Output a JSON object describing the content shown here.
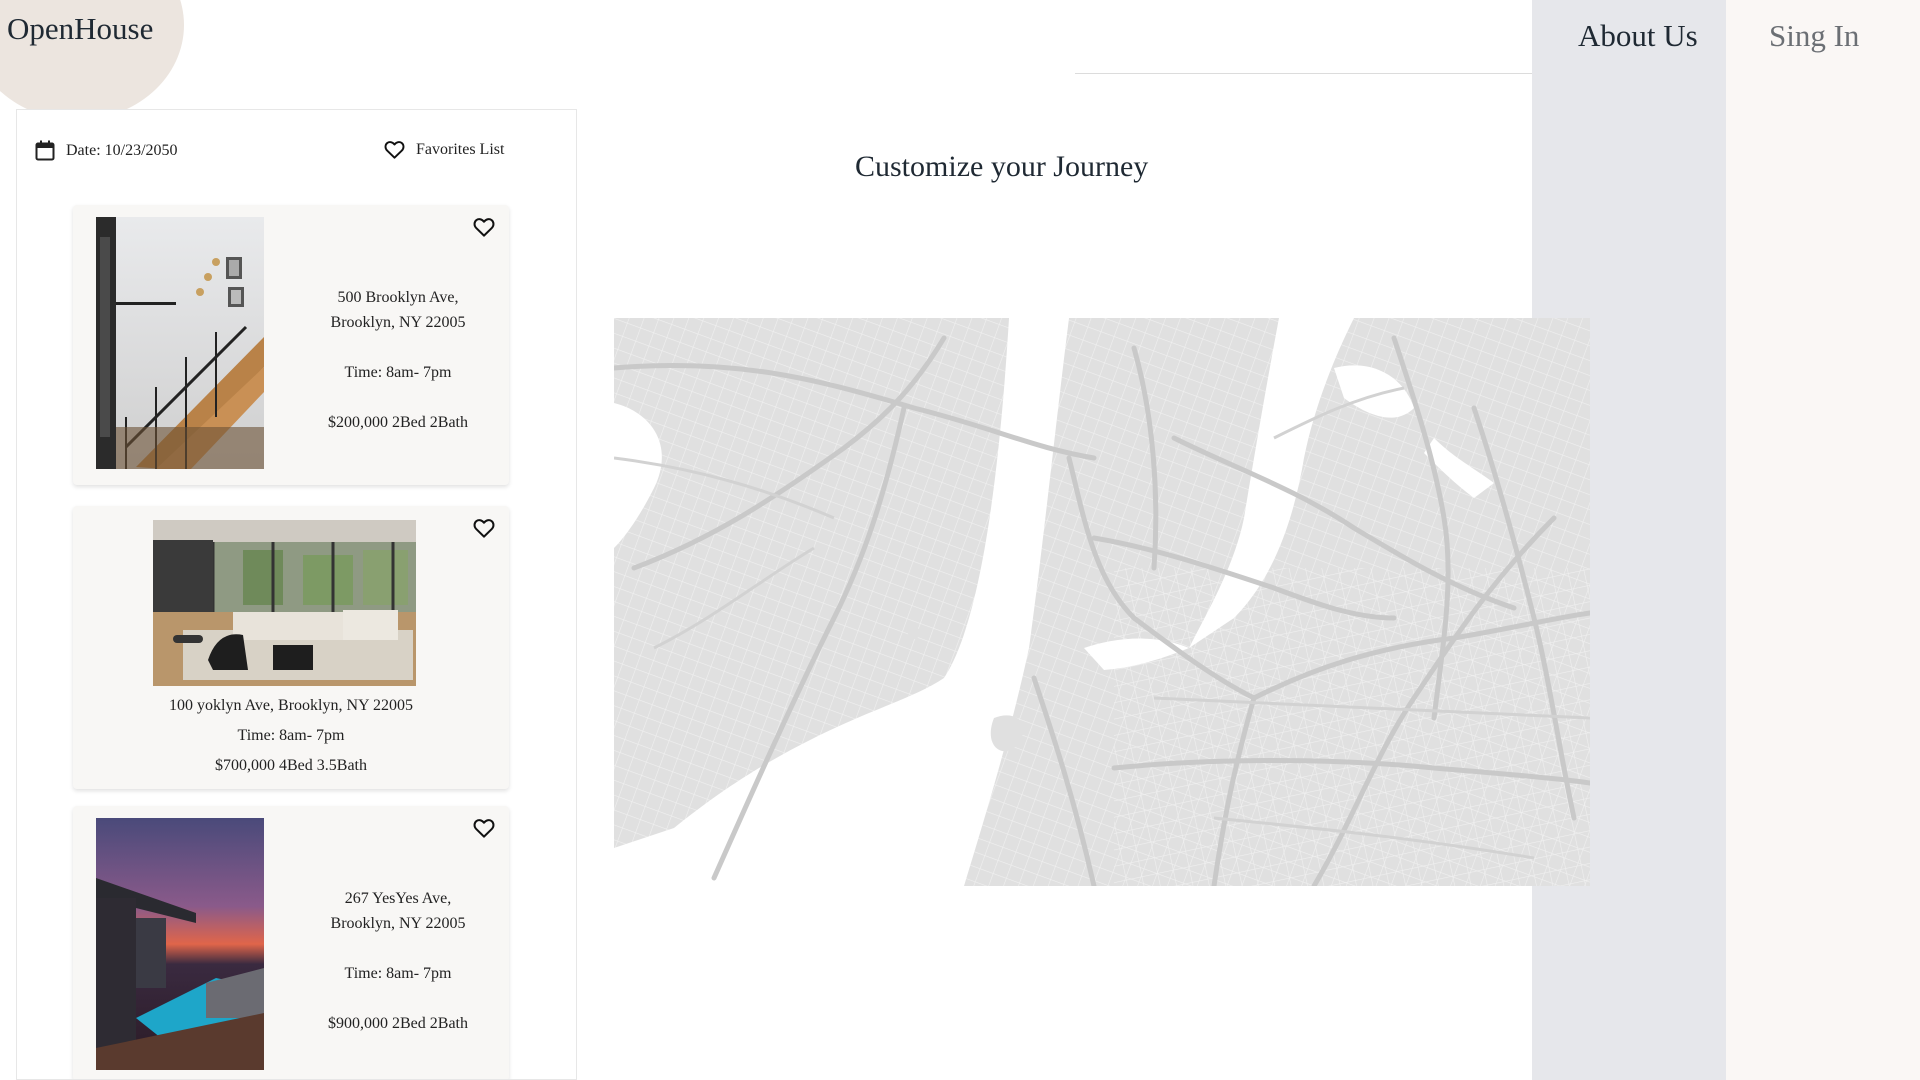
{
  "brand": {
    "name": "OpenHouse"
  },
  "nav": {
    "about": "About Us",
    "signin": "Sing In"
  },
  "sidebar": {
    "date_label": "Date: 10/23/2050",
    "favorites_label": "Favorites List",
    "icons": {
      "date": "calendar-icon",
      "favorites": "heart-icon"
    },
    "listings": [
      {
        "address_line1": "500 Brooklyn Ave,",
        "address_line2": "Brooklyn, NY 22005",
        "time": "Time: 8am- 7pm",
        "details": "$200,000  2Bed 2Bath",
        "photo": "interior staircase"
      },
      {
        "address": "100 yoklyn Ave, Brooklyn, NY 22005",
        "time": "Time: 8am- 7pm",
        "details": "$700,000  4Bed 3.5Bath",
        "photo": "living room"
      },
      {
        "address_line1": "267 YesYes Ave,",
        "address_line2": "Brooklyn, NY 22005",
        "time": "Time: 8am- 7pm",
        "details": "$900,000  2Bed 2Bath",
        "photo": "rooftop pool at sunset"
      }
    ]
  },
  "main": {
    "title": "Customize your Journey"
  },
  "colors": {
    "about_bg": "#e6e7eb",
    "signin_bg": "#faf7f5",
    "logo_circle": "#ece5df",
    "card_bg": "#f8f7f5",
    "map_land": "#e2e2e2",
    "map_water": "#ffffff"
  }
}
